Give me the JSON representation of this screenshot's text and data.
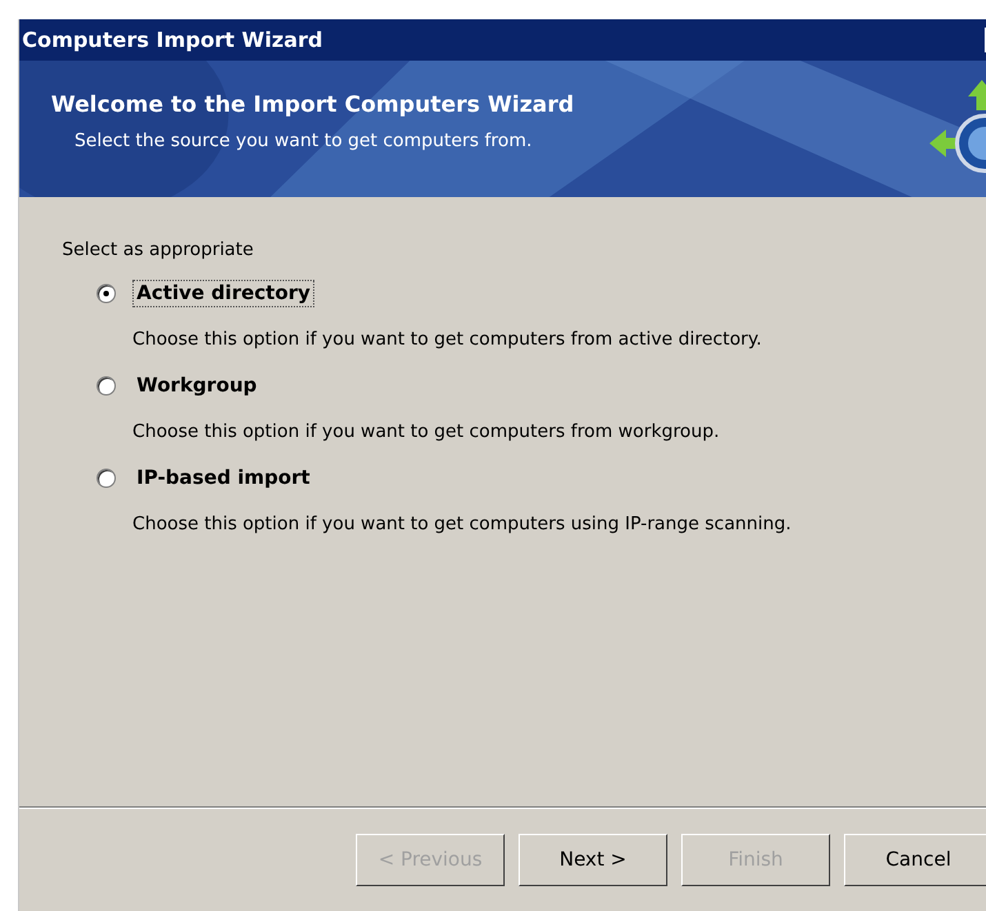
{
  "window": {
    "title": "Computers Import Wizard"
  },
  "banner": {
    "title": "Welcome to the Import Computers Wizard",
    "subtitle": "Select the source you want to get computers from."
  },
  "prompt": "Select as appropriate",
  "options": [
    {
      "label": "Active directory",
      "description": "Choose this option if you want to get computers from active directory.",
      "selected": true
    },
    {
      "label": "Workgroup",
      "description": "Choose this option if you want to get computers from workgroup.",
      "selected": false
    },
    {
      "label": "IP-based import",
      "description": "Choose this option if you want to get computers using IP-range scanning.",
      "selected": false
    }
  ],
  "buttons": [
    {
      "label": "< Previous",
      "disabled": true
    },
    {
      "label": "Next >",
      "disabled": false
    },
    {
      "label": "Finish",
      "disabled": true
    },
    {
      "label": "Cancel",
      "disabled": false
    }
  ]
}
